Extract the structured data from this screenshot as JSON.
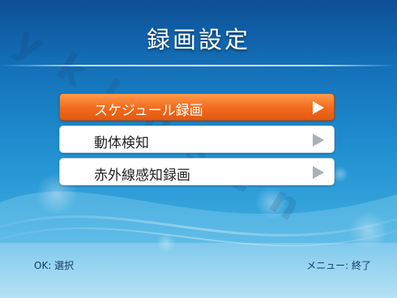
{
  "screen": {
    "title": "録画設定",
    "watermark": "ykkusen"
  },
  "menu": {
    "items": [
      {
        "label": "スケジュール録画",
        "selected": true
      },
      {
        "label": "動体検知",
        "selected": false
      },
      {
        "label": "赤外線感知録画",
        "selected": false
      }
    ]
  },
  "footer": {
    "left": "OK: 選択",
    "right": "メニュー: 終了"
  },
  "colors": {
    "selected_item": "#f26a1c",
    "item_background": "#ffffff",
    "background_top": "#0d4f96",
    "background_bottom": "#6cc3ea",
    "footer_text": "#163a68"
  }
}
